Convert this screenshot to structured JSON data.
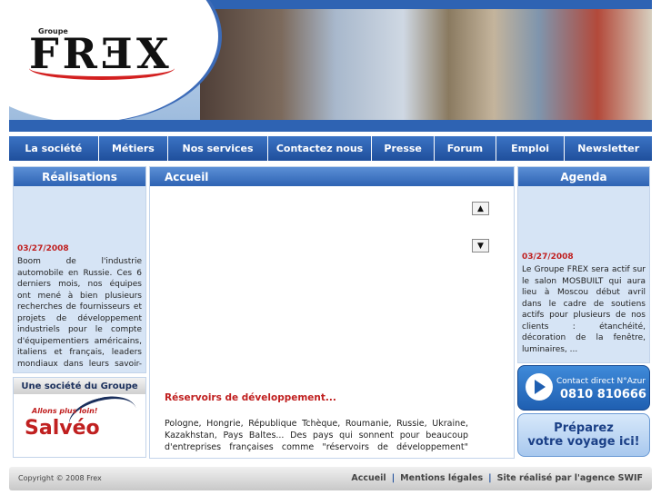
{
  "header": {
    "logo_top": "Groupe",
    "logo_main": "FRƎX"
  },
  "nav": [
    "La société",
    "Métiers",
    "Nos services",
    "Contactez nous",
    "Presse",
    "Forum",
    "Emploi",
    "Newsletter"
  ],
  "left": {
    "realisations_title": "Réalisations",
    "news_date": "03/27/2008",
    "news_text": "Boom de l'industrie automobile en Russie. Ces 6 derniers mois, nos équipes ont mené à bien plusieurs recherches de fournisseurs et projets de développement industriels pour le compte d'équipementiers américains, italiens et français, leaders mondiaux dans leurs savoir-faire. Bravo et",
    "group_title": "Une société du Groupe",
    "salveo_tag": "Allons plus loin!",
    "salveo_name": "Salvéo"
  },
  "main": {
    "title": "Accueil",
    "arrow_up": "▲",
    "arrow_down": "▼",
    "headline": "Réservoirs de développement...",
    "paragraph": "Pologne, Hongrie, République Tchèque, Roumanie, Russie, Ukraine, Kazakhstan, Pays Baltes... Des pays qui sonnent pour beaucoup d'entreprises françaises comme \"réservoirs de développement\" (nouvel"
  },
  "right": {
    "agenda_title": "Agenda",
    "news_date": "03/27/2008",
    "news_text": "Le Groupe FREX sera actif sur le salon MOSBUILT qui aura lieu à Moscou début avril dans le cadre de soutiens actifs pour plusieurs de nos clients : étanchéité, décoration de la fenêtre, luminaires, ...",
    "contact_line1": "Contact direct N°Azur",
    "contact_line2": "0810 810666",
    "voyage_line1": "Préparez",
    "voyage_line2": "votre voyage ici!"
  },
  "footer": {
    "copyright": "Copyright © 2008 Frex",
    "links": [
      "Accueil",
      "Mentions légales",
      "Site réalisé par l'agence SWIF"
    ],
    "separator": "|"
  }
}
